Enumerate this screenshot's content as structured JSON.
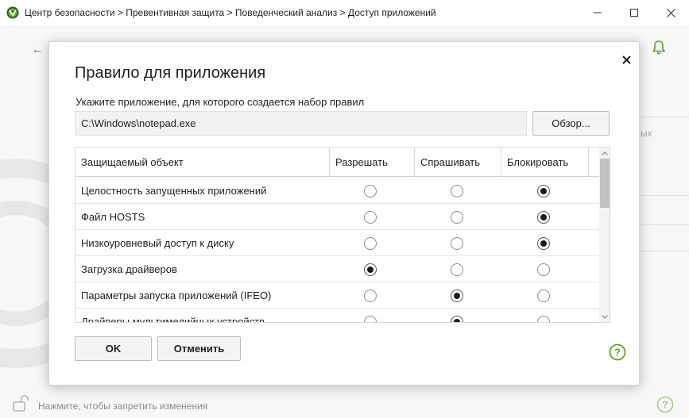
{
  "window": {
    "title": "Центр безопасности > Превентивная защита > Поведенческий анализ > Доступ приложений"
  },
  "background": {
    "partial_text": "ых",
    "lock_hint": "Нажмите, чтобы запретить изменения"
  },
  "dialog": {
    "title": "Правило для приложения",
    "path_label": "Укажите приложение, для которого создается набор правил",
    "path_value": "C:\\Windows\\notepad.exe",
    "browse_label": "Обзор...",
    "ok_label": "OK",
    "cancel_label": "Отменить"
  },
  "table": {
    "headers": [
      "Защищаемый объект",
      "Разрешать",
      "Спрашивать",
      "Блокировать"
    ],
    "rows": [
      {
        "name": "Целостность запущенных приложений",
        "selected": 3
      },
      {
        "name": "Файл HOSTS",
        "selected": 3
      },
      {
        "name": "Низкоуровневый доступ к диску",
        "selected": 3
      },
      {
        "name": "Загрузка драйверов",
        "selected": 1
      },
      {
        "name": "Параметры запуска приложений (IFEO)",
        "selected": 2
      },
      {
        "name": "Драйверы мультимедийных устройств",
        "selected": 2
      }
    ]
  },
  "colors": {
    "accent_green": "#5aa02c",
    "logo_dark": "#2d5a13"
  },
  "icons": {
    "logo": "drweb-spider-icon",
    "bell": "bell-icon",
    "lock": "unlock-icon",
    "help": "question-circle-icon"
  }
}
